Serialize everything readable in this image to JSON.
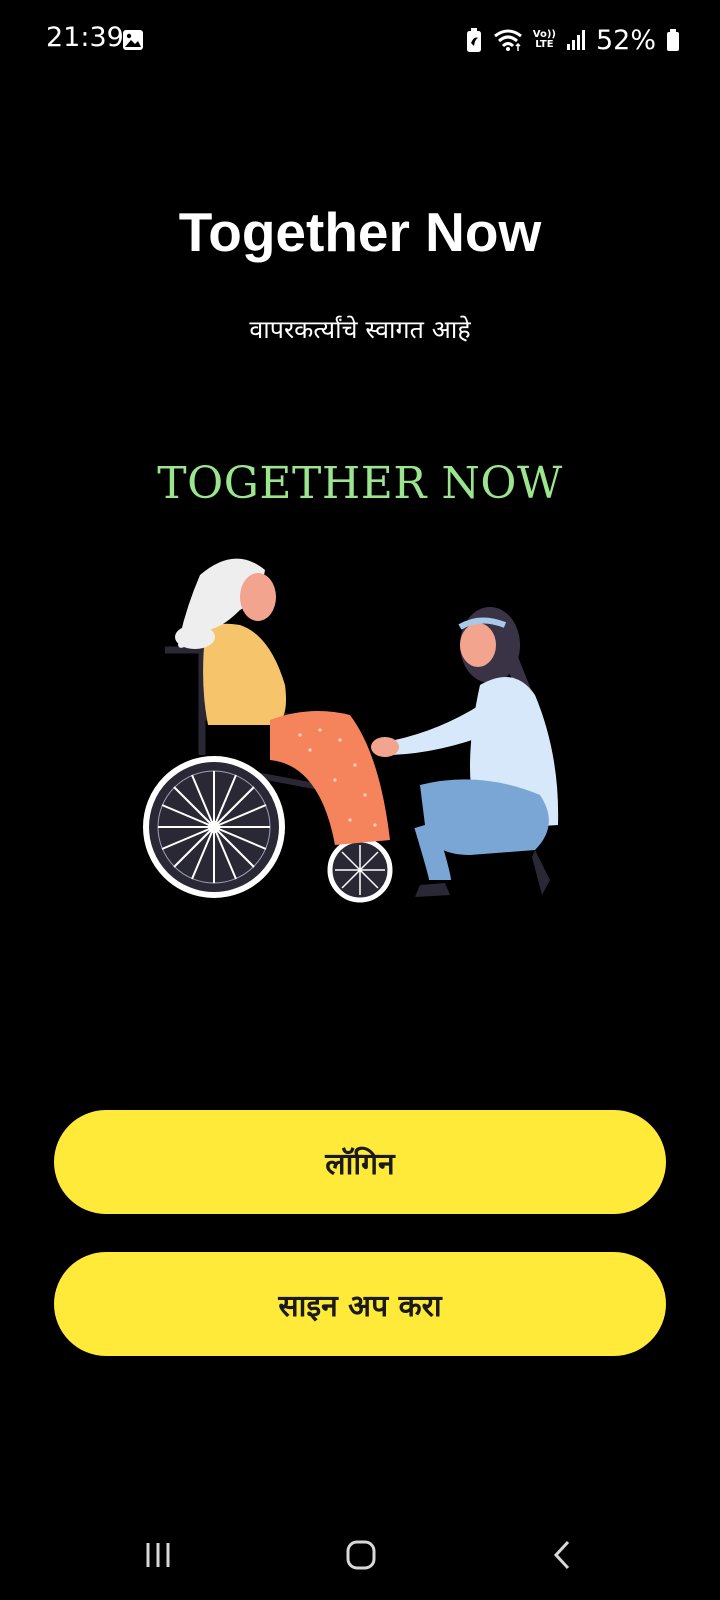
{
  "status_bar": {
    "time": "21:39",
    "volte_top": "Vo))",
    "volte_bottom": "LTE",
    "battery_percent": "52%",
    "icons": [
      "gallery-icon",
      "battery-saver-icon",
      "wifi-icon",
      "volte-icon",
      "signal-icon",
      "battery-icon"
    ]
  },
  "header": {
    "title": "Together Now",
    "welcome": "वापरकर्त्यांचे स्वागत आहे"
  },
  "logo": {
    "text": "TOGETHER NOW",
    "color": "#9be58e"
  },
  "illustration": {
    "icon": "caregiver-wheelchair-illustration"
  },
  "buttons": {
    "login_label": "लॉगिन",
    "signup_label": "साइन अप करा",
    "color": "#ffea3a"
  },
  "nav_bar": {
    "icons": [
      "recent-apps-icon",
      "home-icon",
      "back-icon"
    ]
  }
}
